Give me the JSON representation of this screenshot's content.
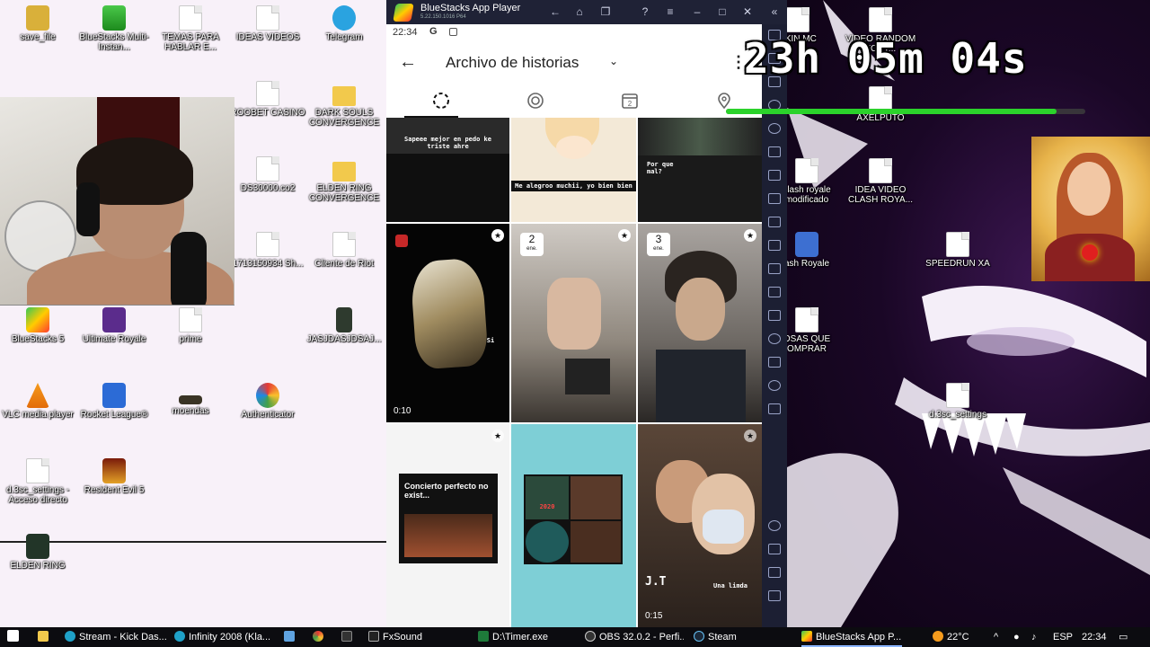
{
  "desktop_left": {
    "icons": [
      {
        "label": "save_file"
      },
      {
        "label": "BlueStacks Multi-Instan..."
      },
      {
        "label": "TEMAS PARA HABLAR E..."
      },
      {
        "label": "IDEAS VIDEOS"
      },
      {
        "label": "Telegram"
      },
      {
        "label": "ROOBET CASINO"
      },
      {
        "label": "DARK SOULS CONVERGENCE"
      },
      {
        "label": "DS30000.co2"
      },
      {
        "label": "ELDEN RING CONVERGENCE"
      },
      {
        "label": "1713150934 Sh..."
      },
      {
        "label": "Cliente de Riot"
      },
      {
        "label": "BlueStacks 5"
      },
      {
        "label": "Ultimate Royale"
      },
      {
        "label": "prime"
      },
      {
        "label": "JASJDASJDSAJ..."
      },
      {
        "label": "VLC media player"
      },
      {
        "label": "Rocket League®"
      },
      {
        "label": "moendas"
      },
      {
        "label": "Authenticator"
      },
      {
        "label": "d.3sc_settings - Acceso directo"
      },
      {
        "label": "Resident Evil 5"
      },
      {
        "label": "ELDEN RING"
      }
    ]
  },
  "desktop_right": {
    "icons": [
      {
        "label": "SKIN MC"
      },
      {
        "label": "VIDEO RANDOM FORT..."
      },
      {
        "label": "AXELPUTO"
      },
      {
        "label": "clash royale modificado"
      },
      {
        "label": "IDEA VIDEO CLASH ROYA..."
      },
      {
        "label": "ash Royale"
      },
      {
        "label": "SPEEDRUN XA"
      },
      {
        "label": "OSAS QUE OMPRAR"
      },
      {
        "label": "d.3sc_settings"
      }
    ]
  },
  "bluestacks": {
    "title": "BlueStacks App Player",
    "version": "5.22.150.1016 P64"
  },
  "phone": {
    "status_time": "22:34",
    "status_g": "G",
    "page_title": "Archivo de historias",
    "tabs": [
      {
        "name": "stories-archive",
        "icon": "story-ring-icon"
      },
      {
        "name": "highlights",
        "icon": "highlight-icon"
      },
      {
        "name": "calendar",
        "icon": "calendar-icon"
      },
      {
        "name": "map",
        "icon": "map-pin-icon"
      }
    ],
    "calendar_icon_day": "2",
    "stories": [
      {
        "caption": "Sapeee mejor en pedo ke triste ahre"
      },
      {
        "caption": "Me alegroo muchii, yo bien bien"
      },
      {
        "caption": "Por que mal?"
      },
      {
        "duration": "0:10",
        "caption": "Si"
      },
      {
        "date_day": "2",
        "date_month": "ene."
      },
      {
        "date_day": "3",
        "date_month": "ene."
      },
      {
        "caption": "Concierto perfecto no exist..."
      },
      {
        "caption": "2020"
      },
      {
        "caption": "Una limda",
        "duration": "0:15",
        "overlay": "J.T"
      }
    ]
  },
  "timer": {
    "text": "23h 05m 04s",
    "progress": 0.92
  },
  "taskbar": {
    "items": [
      {
        "label": "Stream - Kick Das..."
      },
      {
        "label": "Infinity 2008 (Kla..."
      },
      {
        "label": "FxSound"
      },
      {
        "label": "D:\\Timer.exe"
      },
      {
        "label": "OBS 32.0.2 - Perfi..."
      },
      {
        "label": "Steam"
      },
      {
        "label": "BlueStacks App P..."
      }
    ],
    "temperature": "22°C",
    "language": "ESP",
    "clock": "22:34"
  },
  "colors": {
    "timer_green": "#2bd22b",
    "bluestacks_chrome": "#1c1f33"
  }
}
